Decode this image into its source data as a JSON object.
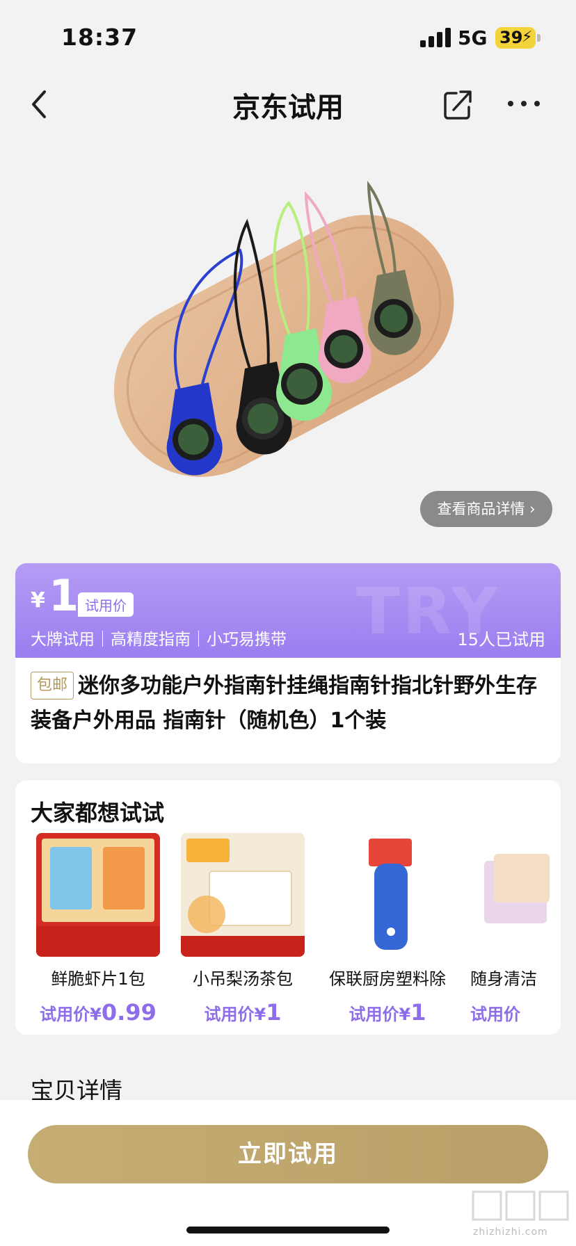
{
  "status": {
    "time": "18:37",
    "network": "5G",
    "battery": "39"
  },
  "nav": {
    "title": "京东试用"
  },
  "product": {
    "detail_button": "查看商品详情",
    "price_currency": "¥",
    "price": "1",
    "price_label": "试用价",
    "tags": "大牌试用｜高精度指南｜小巧易携带",
    "tried_count": "15人已试用",
    "free_shipping": "包邮",
    "title": "迷你多功能户外指南针挂绳指南针指北针野外生存装备户外用品 指南针（随机色）1个装",
    "watermark": "TRY"
  },
  "recommend": {
    "title": "大家都想试试",
    "items": [
      {
        "name": "鲜脆虾片1包",
        "price_label": "试用价¥",
        "price": "0.99"
      },
      {
        "name": "小吊梨汤茶包",
        "price_label": "试用价¥",
        "price": "1"
      },
      {
        "name": "保联厨房塑料除",
        "price_label": "试用价¥",
        "price": "1"
      },
      {
        "name": "随身清洁",
        "price_label": "试用价",
        "price": ""
      }
    ]
  },
  "detail_heading": "宝贝详情",
  "cta": {
    "label": "立即试用"
  },
  "site": {
    "mark": "zhizhizhi.com"
  },
  "colors": {
    "accent": "#9a7ef0",
    "gold": "#c6ad73"
  }
}
